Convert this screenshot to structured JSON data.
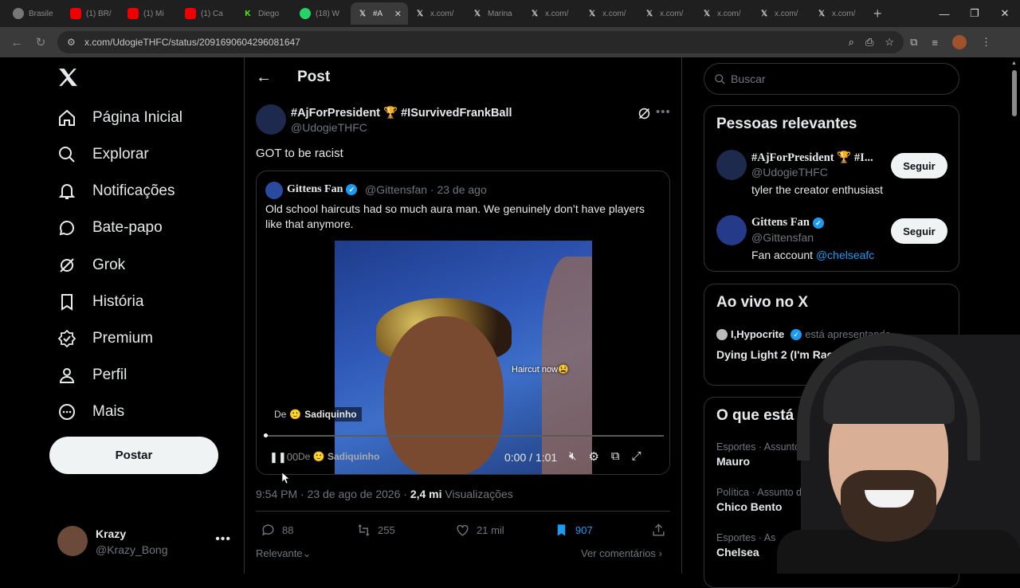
{
  "browser": {
    "tabs": [
      {
        "label": "Brasile",
        "icon": "globe"
      },
      {
        "label": "(1) BR/",
        "icon": "youtube"
      },
      {
        "label": "(1) Mi",
        "icon": "youtube"
      },
      {
        "label": "(1) Ca",
        "icon": "youtube"
      },
      {
        "label": "Diego",
        "icon": "kick"
      },
      {
        "label": "(18) W",
        "icon": "whatsapp"
      },
      {
        "label": "#A",
        "icon": "x",
        "active": true
      },
      {
        "label": "x.com/",
        "icon": "x"
      },
      {
        "label": "Marina",
        "icon": "x"
      },
      {
        "label": "x.com/",
        "icon": "x"
      },
      {
        "label": "x.com/",
        "icon": "x"
      },
      {
        "label": "x.com/",
        "icon": "x"
      },
      {
        "label": "x.com/",
        "icon": "x"
      },
      {
        "label": "x.com/",
        "icon": "x"
      },
      {
        "label": "x.com/",
        "icon": "x"
      }
    ],
    "url": "x.com/UdogieTHFC/status/2091690604296081647"
  },
  "sidebar": {
    "nav": [
      {
        "label": "Página Inicial",
        "icon": "home-icon"
      },
      {
        "label": "Explorar",
        "icon": "search-icon"
      },
      {
        "label": "Notificações",
        "icon": "bell-icon"
      },
      {
        "label": "Bate-papo",
        "icon": "chat-icon"
      },
      {
        "label": "Grok",
        "icon": "grok-icon"
      },
      {
        "label": "História",
        "icon": "bookmark-icon"
      },
      {
        "label": "Premium",
        "icon": "verified-icon"
      },
      {
        "label": "Perfil",
        "icon": "person-icon"
      },
      {
        "label": "Mais",
        "icon": "more-circle-icon"
      }
    ],
    "post_button": "Postar",
    "account": {
      "name": "Krazy",
      "handle": "@Krazy_Bong"
    }
  },
  "post": {
    "header_title": "Post",
    "author_name": "#AjForPresident 🏆 #ISurvivedFrankBall",
    "author_handle": "@UdogieTHFC",
    "text": "GOT to be racist",
    "quote": {
      "name": "Gittens Fan",
      "handle_date": "@Gittensfan · 23 de ago",
      "text": "Old school haircuts had so much aura man. We genuinely don’t have players like that anymore.",
      "video": {
        "caption": "Haircut now😫",
        "from_prefix": "De",
        "from_name": "Sadiquinho",
        "time": "0:00 / 1:01",
        "played": "00",
        "progress": 0
      }
    },
    "meta": {
      "time_date": "9:54 PM · 23 de ago de 2026 ·",
      "views_count": "2,4 mi",
      "views_label": "Visualizações"
    },
    "actions": {
      "replies": "88",
      "reposts": "255",
      "likes": "21 mil",
      "bookmarks": "907"
    },
    "sort_label": "Relevante",
    "view_comments": "Ver comentários"
  },
  "right": {
    "search_placeholder": "Buscar",
    "relevant_people": {
      "title": "Pessoas relevantes",
      "people": [
        {
          "name": "#AjForPresident 🏆 #I...",
          "handle": "@UdogieTHFC",
          "bio": "tyler the creator enthusiast",
          "button": "Seguir"
        },
        {
          "name": "Gittens Fan",
          "handle": "@Gittensfan",
          "bio_prefix": "Fan account",
          "bio_link": "@chelseafc",
          "button": "Seguir"
        }
      ]
    },
    "live": {
      "title": "Ao vivo no X",
      "host": "Ι,Hypocrite",
      "host_suffix": "está apresentando",
      "stream_title": "Dying Light 2 (I'm Rac... Against it)"
    },
    "trends": {
      "title": "O que está a",
      "items": [
        {
          "category": "Esportes · Assunto d",
          "name": "Mauro"
        },
        {
          "category": "Política · Assunto do Mome",
          "name": "Chico Bento"
        },
        {
          "category": "Esportes · As",
          "name": "Chelsea"
        }
      ]
    }
  },
  "colors": {
    "accent": "#1d9bf0",
    "background": "#000000",
    "border": "#2f3336",
    "muted": "#71767b"
  }
}
